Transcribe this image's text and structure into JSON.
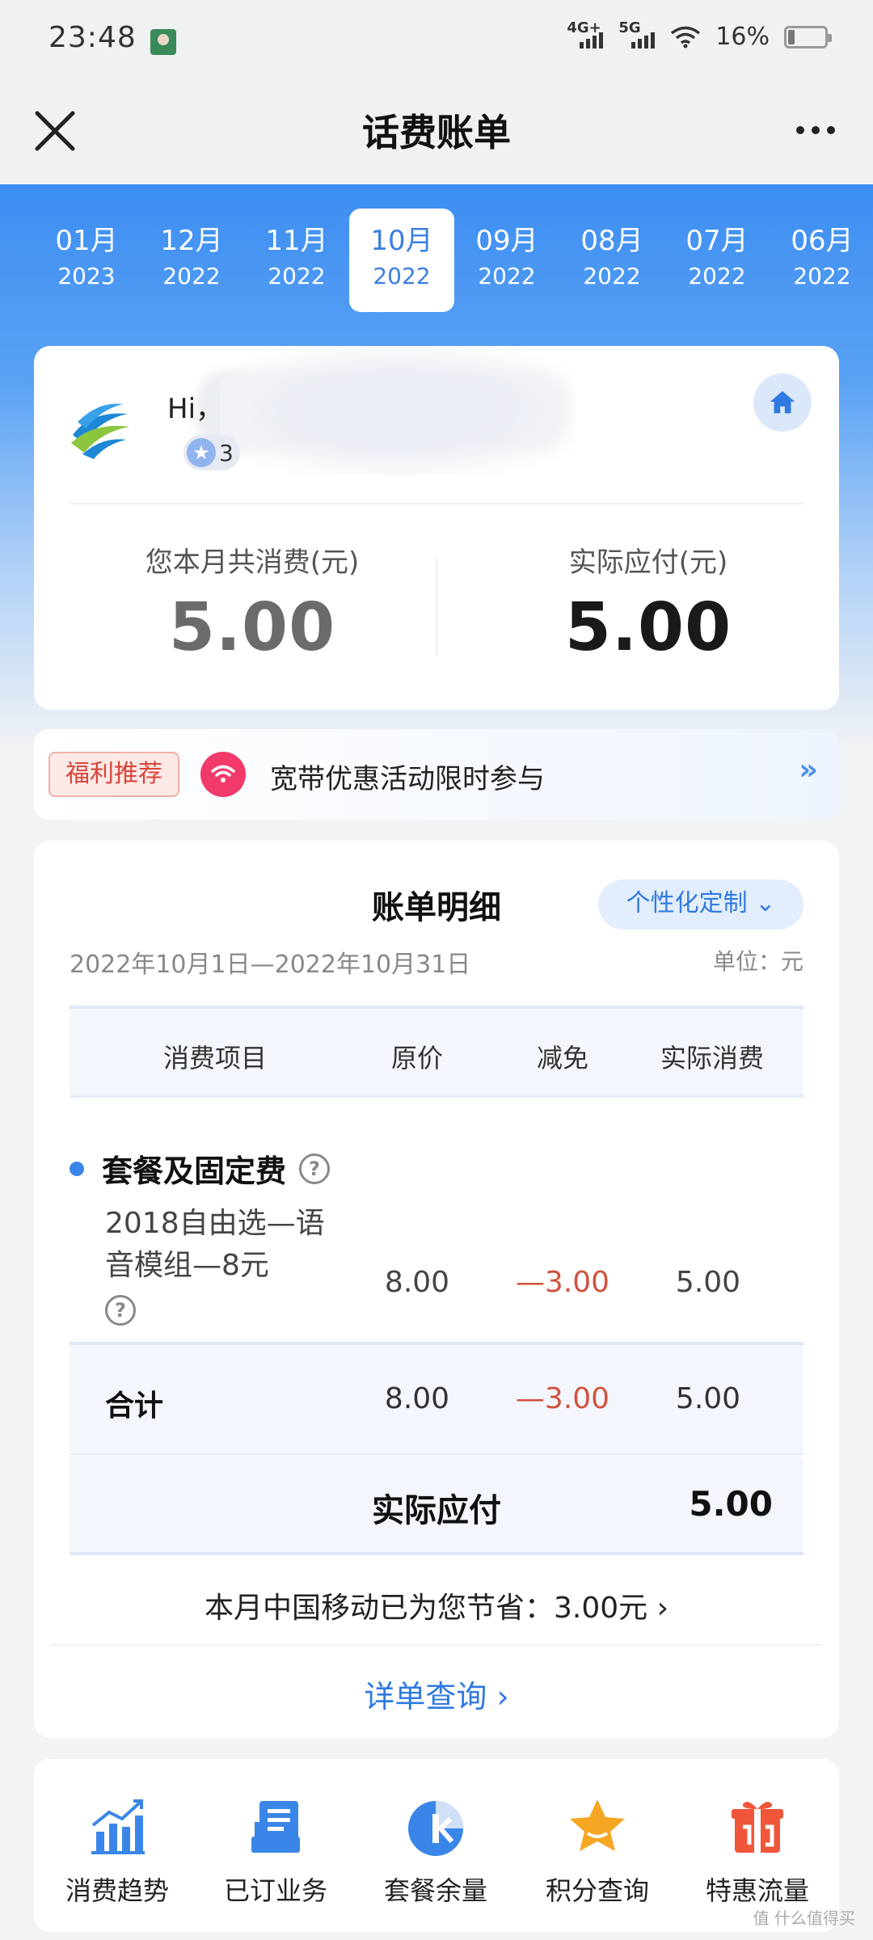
{
  "status_bar": {
    "time": "23:48",
    "signal1_label": "4G+",
    "signal2_label": "5G",
    "battery": "16%"
  },
  "header": {
    "title": "话费账单"
  },
  "months": [
    {
      "m": "01月",
      "y": "2023"
    },
    {
      "m": "12月",
      "y": "2022"
    },
    {
      "m": "11月",
      "y": "2022"
    },
    {
      "m": "10月",
      "y": "2022"
    },
    {
      "m": "09月",
      "y": "2022"
    },
    {
      "m": "08月",
      "y": "2022"
    },
    {
      "m": "07月",
      "y": "2022"
    },
    {
      "m": "06月",
      "y": "2022"
    }
  ],
  "account": {
    "greeting": "Hi，",
    "level": "3",
    "total_label": "您本月共消费(元)",
    "total_value": "5.00",
    "payable_label": "实际应付(元)",
    "payable_value": "5.00"
  },
  "promo": {
    "tag": "福利推荐",
    "text": "宽带优惠活动限时参与",
    "arrow": "››"
  },
  "bill": {
    "title": "账单明细",
    "customize": "个性化定制 ⌄",
    "period": "2022年10月1日—2022年10月31日",
    "unit": "单位：元",
    "columns": [
      "消费项目",
      "原价",
      "减免",
      "实际消费"
    ],
    "category": "套餐及固定费",
    "item": {
      "name": "2018自由选—语音模组—8元",
      "original": "8.00",
      "discount": "—3.00",
      "actual": "5.00"
    },
    "total": {
      "label": "合计",
      "original": "8.00",
      "discount": "—3.00",
      "actual": "5.00"
    },
    "payable": {
      "label": "实际应付",
      "value": "5.00"
    },
    "saved": "本月中国移动已为您节省：3.00元 ›",
    "detail_link": "详单查询 ›"
  },
  "shortcuts": [
    {
      "label": "消费趋势",
      "icon": "trend-chart-icon"
    },
    {
      "label": "已订业务",
      "icon": "subscribed-list-icon"
    },
    {
      "label": "套餐余量",
      "icon": "plan-remaining-icon"
    },
    {
      "label": "积分查询",
      "icon": "points-star-icon"
    },
    {
      "label": "特惠流量",
      "icon": "gift-data-icon"
    }
  ],
  "watermark": "值 什么值得买",
  "colors": {
    "accent": "#3d8ef2",
    "link": "#2f7ae0",
    "negative": "#d0533e",
    "promo_tag": "#d9443a"
  }
}
